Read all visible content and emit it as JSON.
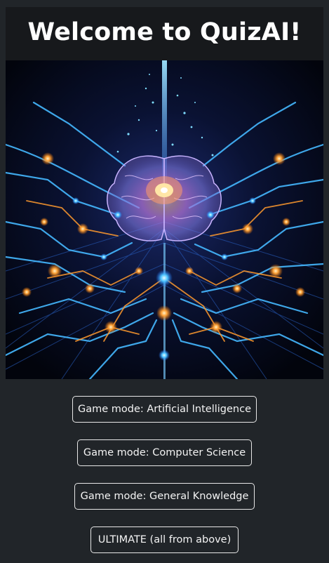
{
  "header": {
    "title": "Welcome to QuizAI!"
  },
  "hero": {
    "image_subject": "glowing-ai-brain-circuit-board",
    "colors": {
      "background": "#030614",
      "circuit_blue": "#3fb7ff",
      "circuit_orange": "#ff9a2e",
      "brain_pink": "#e9a6ff",
      "core_glow": "#ffd27a"
    }
  },
  "game_modes": [
    {
      "label": "Game mode: Artificial Intelligence"
    },
    {
      "label": "Game mode: Computer Science"
    },
    {
      "label": "Game mode: General Knowledge"
    },
    {
      "label": "ULTIMATE (all from above)"
    }
  ],
  "theme": {
    "page_background": "#212529",
    "header_background": "#17191c",
    "text": "#ffffff",
    "button_border": "#e8e8e8"
  }
}
